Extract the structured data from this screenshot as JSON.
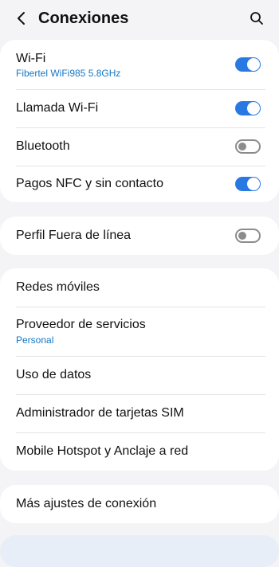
{
  "header": {
    "title": "Conexiones",
    "back_icon": "chevron-left-icon",
    "search_icon": "search-icon"
  },
  "colors": {
    "accent": "#2979e3",
    "subtext": "#1677c5",
    "background": "#f4f4f6",
    "card": "#ffffff"
  },
  "groups": [
    {
      "items": [
        {
          "label": "Wi-Fi",
          "sub": "Fibertel WiFi985 5.8GHz",
          "toggle": "on"
        },
        {
          "label": "Llamada Wi-Fi",
          "toggle": "on"
        },
        {
          "label": "Bluetooth",
          "toggle": "off"
        },
        {
          "label": "Pagos NFC y sin contacto",
          "toggle": "on"
        }
      ]
    },
    {
      "items": [
        {
          "label": "Perfil Fuera de línea",
          "toggle": "off"
        }
      ]
    },
    {
      "items": [
        {
          "label": "Redes móviles"
        },
        {
          "label": "Proveedor de servicios",
          "sub": "Personal"
        },
        {
          "label": "Uso de datos"
        },
        {
          "label": "Administrador de tarjetas SIM"
        },
        {
          "label": "Mobile Hotspot y Anclaje a red"
        }
      ]
    },
    {
      "items": [
        {
          "label": "Más ajustes de conexión"
        }
      ]
    }
  ]
}
